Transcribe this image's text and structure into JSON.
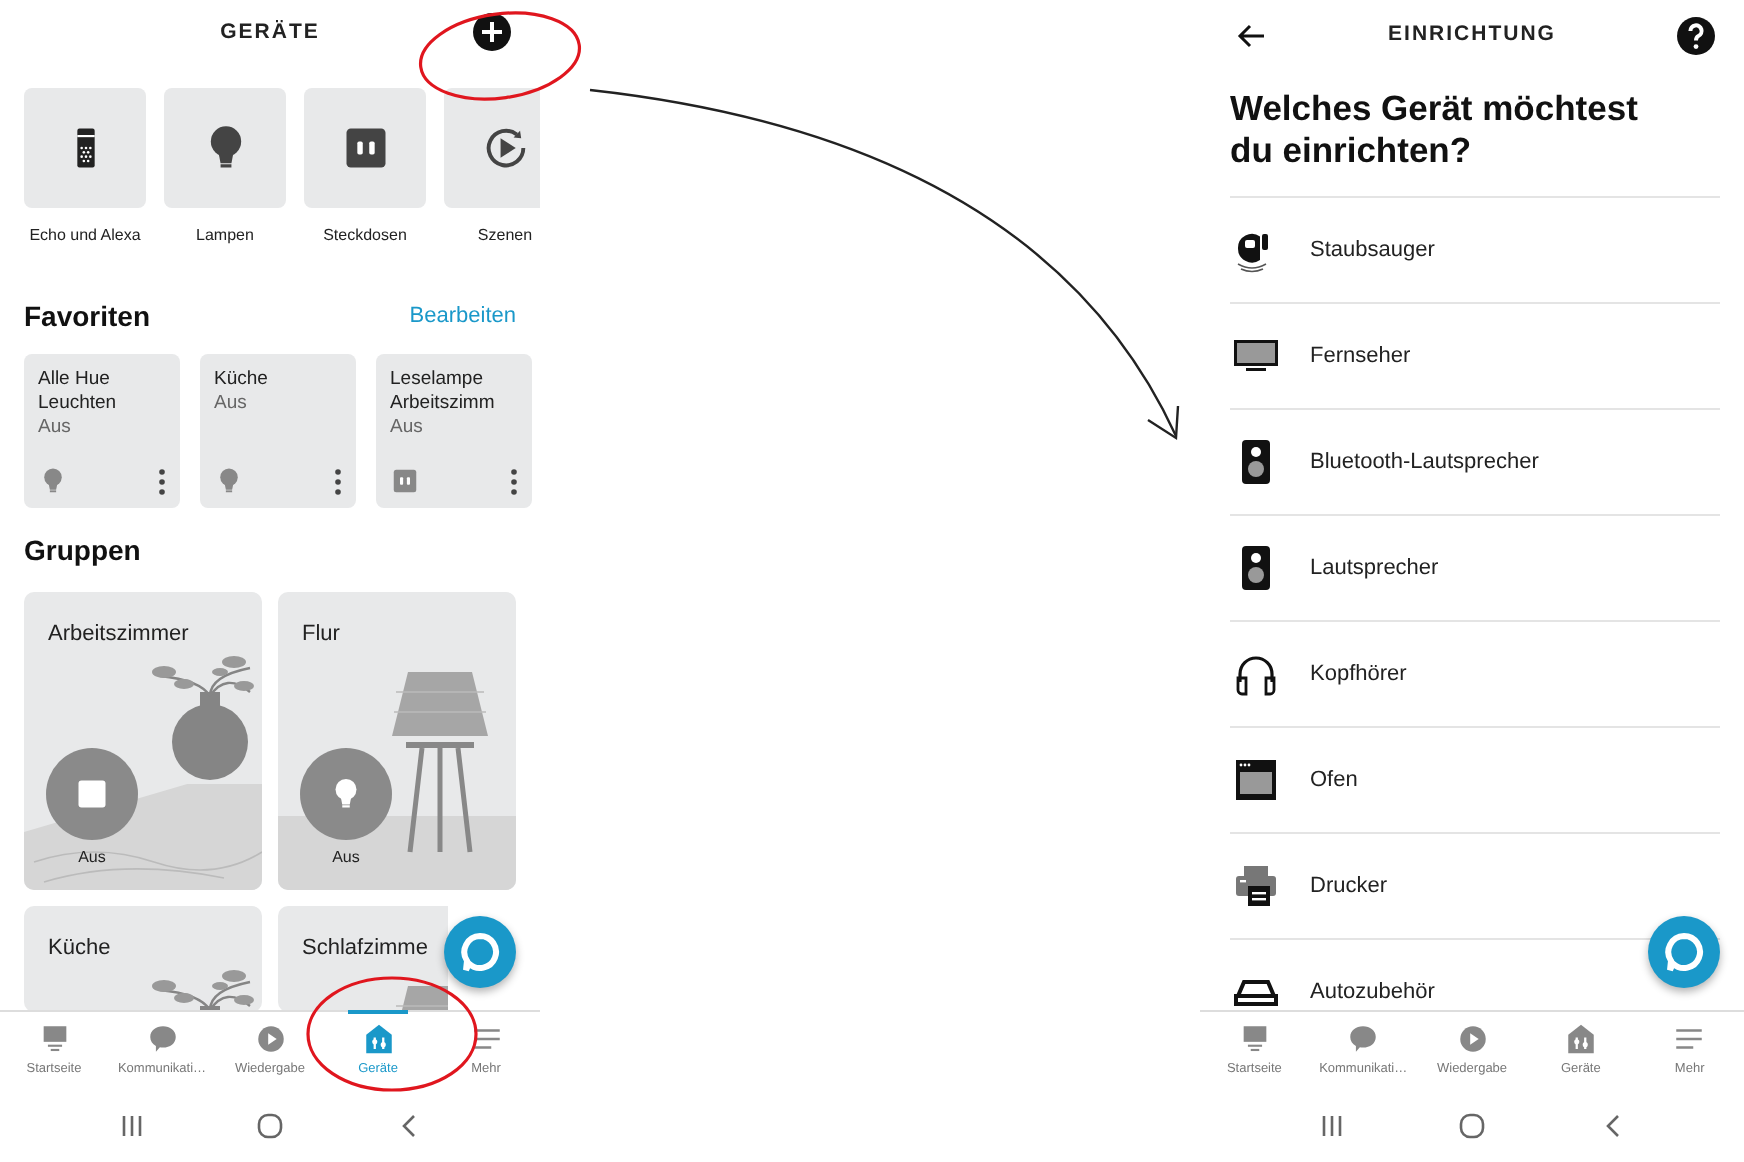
{
  "left_screen": {
    "title": "GERÄTE",
    "categories": [
      {
        "label": "Echo und Alexa",
        "kind": "echo"
      },
      {
        "label": "Lampen",
        "kind": "bulb"
      },
      {
        "label": "Steckdosen",
        "kind": "plug"
      },
      {
        "label": "Szenen",
        "kind": "scene"
      }
    ],
    "favorites": {
      "heading": "Favoriten",
      "action": "Bearbeiten",
      "items": [
        {
          "name": "Alle Hue Leuchten",
          "state": "Aus",
          "kind": "bulb"
        },
        {
          "name": "Küche",
          "state": "Aus",
          "kind": "bulb"
        },
        {
          "name": "Leselampe Arbeitszimm",
          "state": "Aus",
          "kind": "plug"
        }
      ]
    },
    "groups": {
      "heading": "Gruppen",
      "items": [
        {
          "name": "Arbeitszimmer",
          "state": "Aus",
          "kind": "plant"
        },
        {
          "name": "Flur",
          "state": "Aus",
          "kind": "lamp"
        },
        {
          "name": "Küche",
          "kind": "plant"
        },
        {
          "name": "Schlafzimme",
          "kind": "lamp"
        }
      ]
    },
    "tab_bar": [
      {
        "label": "Startseite",
        "selected": false
      },
      {
        "label": "Kommunikati…",
        "selected": false
      },
      {
        "label": "Wiedergabe",
        "selected": false
      },
      {
        "label": "Geräte",
        "selected": true
      },
      {
        "label": "Mehr",
        "selected": false
      }
    ]
  },
  "right_screen": {
    "title": "EINRICHTUNG",
    "heading": "Welches Gerät möchtest du einrichten?",
    "device_types": [
      {
        "label": "Staubsauger",
        "kind": "vacuum"
      },
      {
        "label": "Fernseher",
        "kind": "tv"
      },
      {
        "label": "Bluetooth-Lautsprecher",
        "kind": "speaker"
      },
      {
        "label": "Lautsprecher",
        "kind": "speaker"
      },
      {
        "label": "Kopfhörer",
        "kind": "headphones"
      },
      {
        "label": "Ofen",
        "kind": "oven"
      },
      {
        "label": "Drucker",
        "kind": "printer"
      },
      {
        "label": "Autozubehör",
        "kind": "car"
      }
    ],
    "tab_bar": [
      {
        "label": "Startseite",
        "selected": false
      },
      {
        "label": "Kommunikati…",
        "selected": false
      },
      {
        "label": "Wiedergabe",
        "selected": false
      },
      {
        "label": "Geräte",
        "selected": false
      },
      {
        "label": "Mehr",
        "selected": false
      }
    ]
  }
}
